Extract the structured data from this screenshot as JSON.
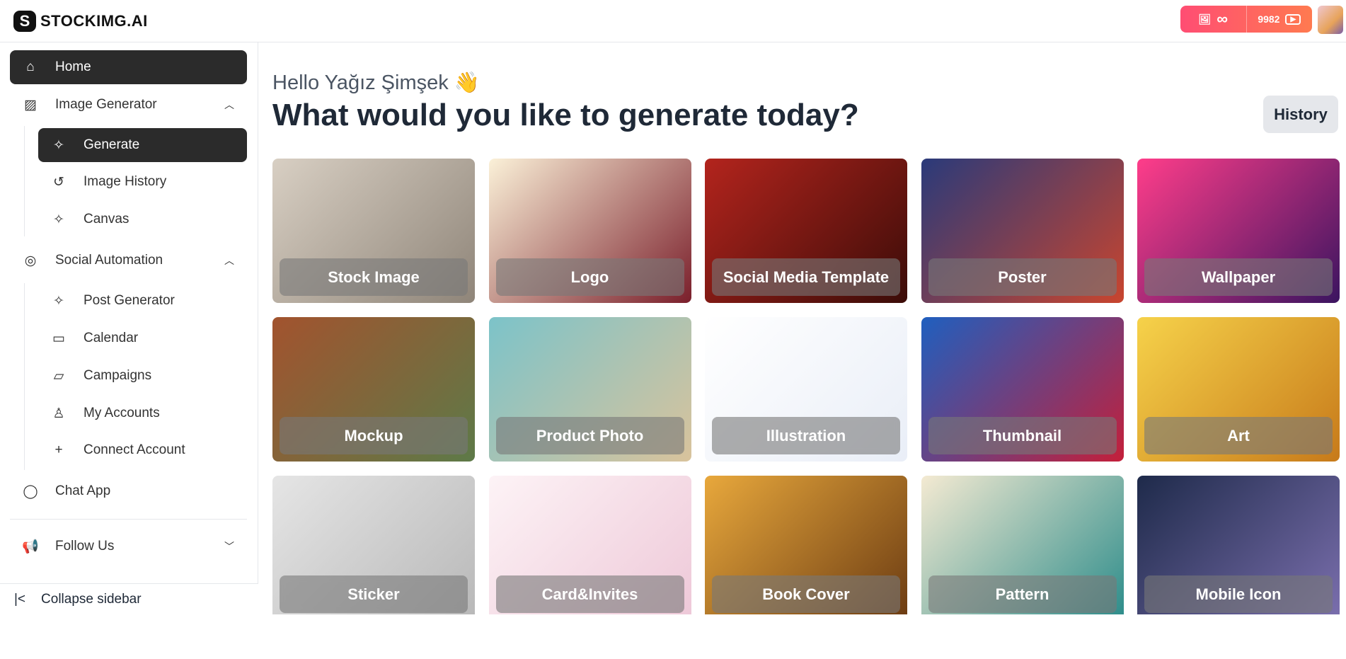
{
  "header": {
    "logo_text": "STOCKIMG.AI",
    "image_credits": "∞",
    "video_credits": "9982"
  },
  "sidebar": {
    "home": "Home",
    "image_generator": {
      "label": "Image Generator",
      "items": [
        "Generate",
        "Image History",
        "Canvas"
      ]
    },
    "social_automation": {
      "label": "Social Automation",
      "items": [
        "Post Generator",
        "Calendar",
        "Campaigns",
        "My Accounts",
        "Connect Account"
      ]
    },
    "chat_app": "Chat App",
    "follow_us": "Follow Us",
    "collapse": "Collapse sidebar"
  },
  "main": {
    "greeting": "Hello Yağız Şimşek 👋",
    "title": "What would you like to generate today?",
    "history_button": "History",
    "cards": [
      {
        "label": "Stock Image",
        "c1": "#d8cfc3",
        "c2": "#8f8579"
      },
      {
        "label": "Logo",
        "c1": "#fbf1d8",
        "c2": "#7a1f2b"
      },
      {
        "label": "Social Media Template",
        "c1": "#b3241d",
        "c2": "#3b0c08"
      },
      {
        "label": "Poster",
        "c1": "#2a3a7a",
        "c2": "#c9452e"
      },
      {
        "label": "Wallpaper",
        "c1": "#ff3d8a",
        "c2": "#3b1460"
      },
      {
        "label": "Mockup",
        "c1": "#a2532e",
        "c2": "#5d7a48"
      },
      {
        "label": "Product Photo",
        "c1": "#7cc3c9",
        "c2": "#d9c39c"
      },
      {
        "label": "Illustration",
        "c1": "#ffffff",
        "c2": "#e9eef7"
      },
      {
        "label": "Thumbnail",
        "c1": "#1f5fbf",
        "c2": "#c41f3a"
      },
      {
        "label": "Art",
        "c1": "#f6d24a",
        "c2": "#c77a1a"
      },
      {
        "label": "Sticker",
        "c1": "#e5e5e5",
        "c2": "#b8b8b8"
      },
      {
        "label": "Card&Invites",
        "c1": "#fdf3f6",
        "c2": "#eec8d8"
      },
      {
        "label": "Book Cover",
        "c1": "#e8a83c",
        "c2": "#6b3b12"
      },
      {
        "label": "Pattern",
        "c1": "#f4ead2",
        "c2": "#2c8c8a"
      },
      {
        "label": "Mobile Icon",
        "c1": "#1e2a4a",
        "c2": "#7b6fae"
      }
    ]
  }
}
